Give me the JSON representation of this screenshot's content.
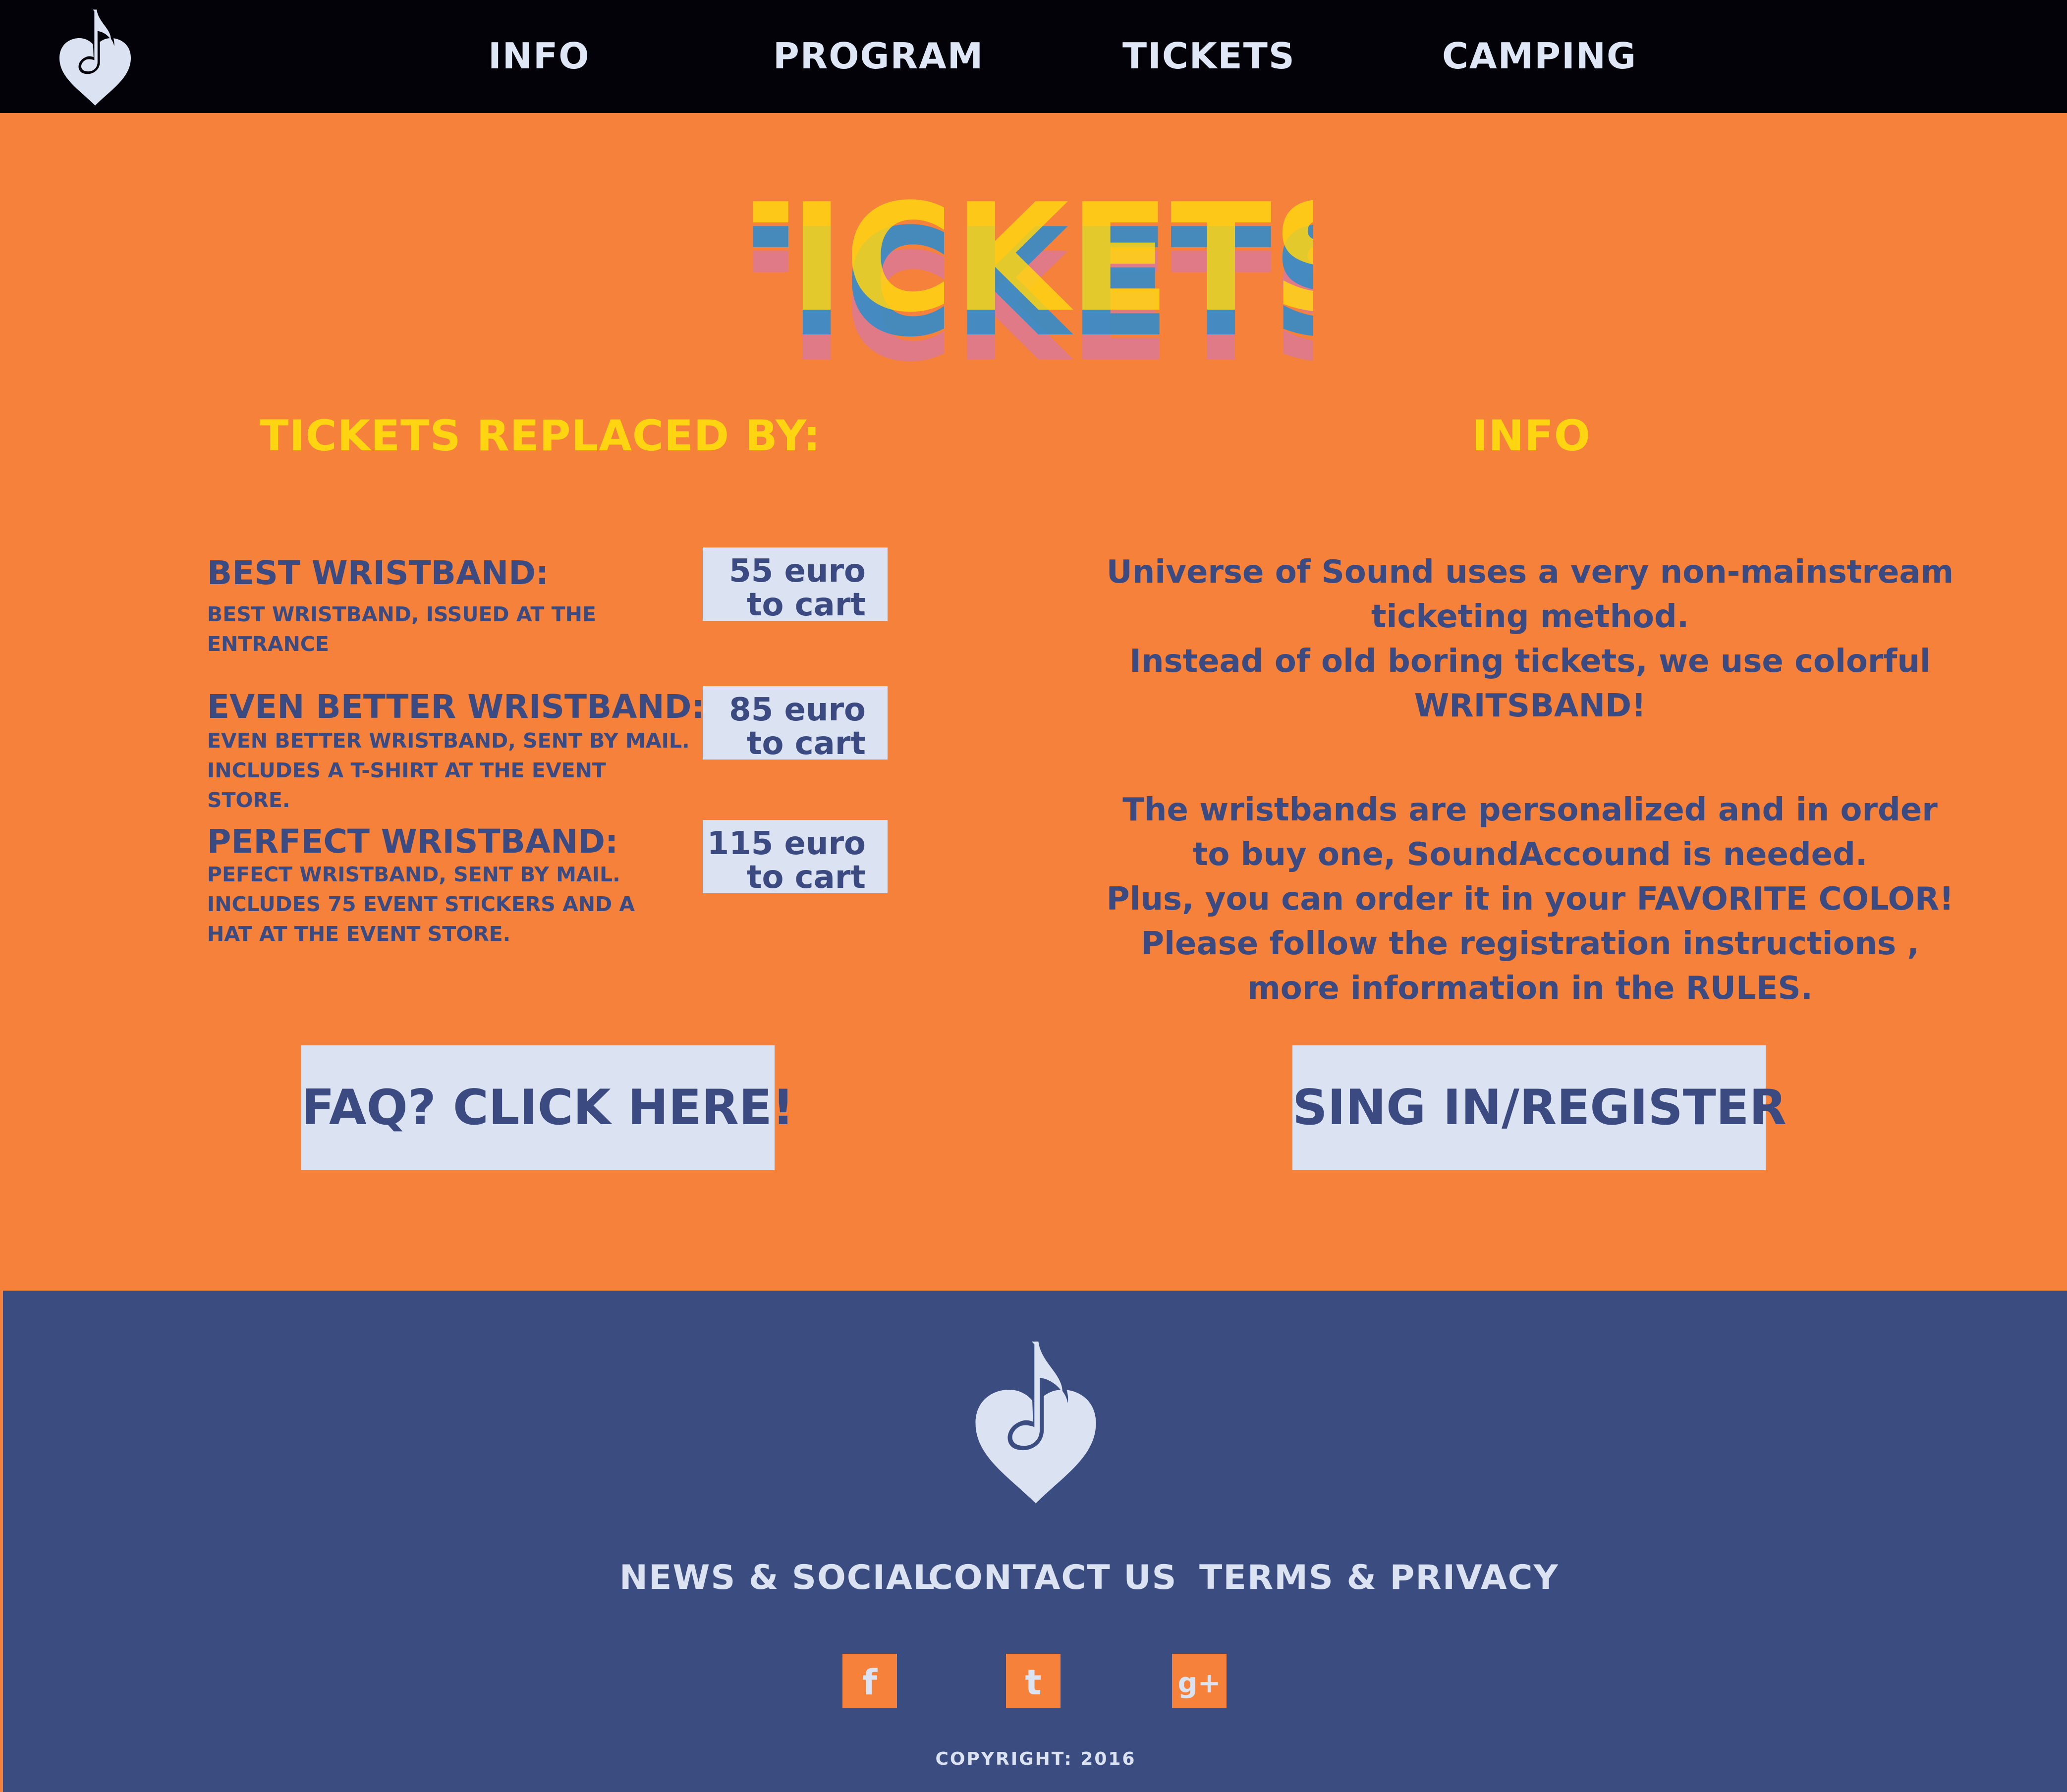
{
  "nav": {
    "items": [
      {
        "label": "INFO"
      },
      {
        "label": "PROGRAM"
      },
      {
        "label": "TICKETS"
      },
      {
        "label": "CAMPING"
      }
    ]
  },
  "hero": {
    "title": "TICKETS"
  },
  "tickets": {
    "heading": "TICKETS REPLACED BY:",
    "tiers": [
      {
        "title": "BEST WRISTBAND:",
        "description": [
          "BEST WRISTBAND, ISSUED AT THE ENTRANCE"
        ],
        "price": "55 euro",
        "cart_label": "to cart"
      },
      {
        "title": "EVEN BETTER WRISTBAND:",
        "description": [
          "EVEN BETTER WRISTBAND, SENT BY MAIL.",
          "INCLUDES A T-SHIRT AT THE EVENT STORE."
        ],
        "price": "85 euro",
        "cart_label": "to cart"
      },
      {
        "title": "PERFECT WRISTBAND:",
        "description": [
          "PEFECT WRISTBAND, SENT BY MAIL.",
          "INCLUDES 75 EVENT STICKERS AND A",
          "HAT AT THE EVENT STORE."
        ],
        "price": "115 euro",
        "cart_label": "to cart"
      }
    ],
    "faq_button": "FAQ? CLICK HERE!"
  },
  "info": {
    "heading": "INFO",
    "paragraph1": [
      "Universe of Sound uses a very non-mainstream",
      "ticketing method.",
      "Instead of old boring tickets, we use colorful",
      "WRITSBAND!"
    ],
    "paragraph2": [
      "The wristbands are personalized and in order",
      "to buy one, SoundAccound is needed.",
      "Plus, you can order it in your FAVORITE COLOR!",
      "Please follow the registration instructions ,",
      "more information in the RULES."
    ],
    "register_button": "SING IN/REGISTER"
  },
  "footer": {
    "links": [
      {
        "label": "NEWS & SOCIAL"
      },
      {
        "label": "CONTACT US"
      },
      {
        "label": "TERMS & PRIVACY"
      }
    ],
    "social": [
      {
        "icon": "facebook-icon",
        "glyph": "f"
      },
      {
        "icon": "twitter-icon",
        "glyph": "t"
      },
      {
        "icon": "google-plus-icon",
        "glyph": "g+"
      }
    ],
    "copyright": "COPYRIGHT: 2016"
  },
  "colors": {
    "background": "#f5813a",
    "nav": "#020208",
    "footer": "#3b4d80",
    "accent_yellow": "#ffd512",
    "text_blue": "#3b4a80",
    "button_light": "#dbe3f2"
  }
}
